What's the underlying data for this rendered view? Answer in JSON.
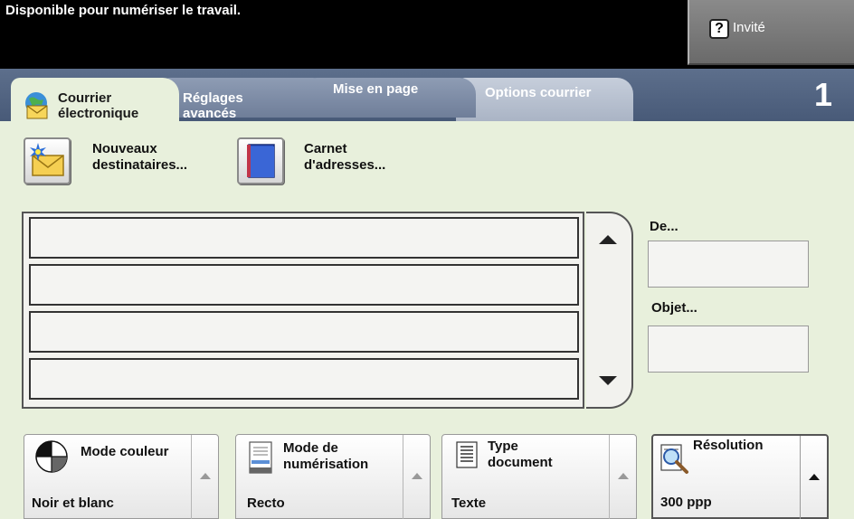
{
  "status": {
    "message": "Disponible pour numériser le travail.",
    "user_label": "Invité"
  },
  "tabs": [
    {
      "label": "Courrier\nélectronique",
      "active": true
    },
    {
      "label": "Réglages\navancés",
      "active": false
    },
    {
      "label": "Mise en page",
      "active": false
    },
    {
      "label": "Options courrier",
      "active": false
    }
  ],
  "job_count": "1",
  "actions": {
    "new_recipients": "Nouveaux\ndestinataires...",
    "address_book": "Carnet\nd'adresses..."
  },
  "recipients": [
    "",
    "",
    "",
    ""
  ],
  "fields": {
    "from_label": "De...",
    "from_value": "",
    "subject_label": "Objet...",
    "subject_value": ""
  },
  "features": {
    "color_mode": {
      "title": "Mode couleur",
      "value": "Noir et blanc"
    },
    "scan_mode": {
      "title": "Mode de\nnumérisation",
      "value": "Recto"
    },
    "doc_type": {
      "title": "Type\ndocument",
      "value": "Texte"
    },
    "resolution": {
      "title": "Résolution",
      "value": "300 ppp"
    }
  },
  "colors": {
    "background": "#e8f0dc",
    "tab_strip": "#5d6f8c",
    "status_bar": "#000000"
  }
}
